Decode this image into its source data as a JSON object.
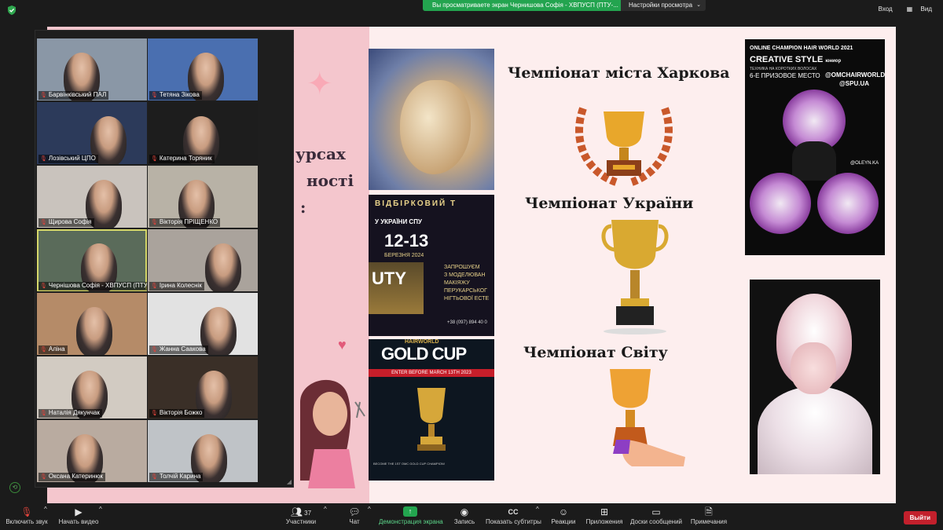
{
  "top_bar": {
    "share_banner": "Вы просматриваете экран Чернишова Софія - ХВПУСП (ПТУ-...",
    "view_settings": "Настройки просмотра",
    "right_items": [
      "Вход",
      "Вид"
    ]
  },
  "slide": {
    "partial_lines": [
      "урсах",
      "ності",
      ":"
    ],
    "champ_city": "Чемпіонат міста Харкова",
    "champ_ukraine": "Чемпіонат України",
    "champ_world": "Чемпіонат Світу",
    "poster1": {
      "heading": "ВІДБІРКОВИЙ Т",
      "subheading": "У УКРАЇНИ СПУ",
      "dates": "12-13",
      "month": "БЕРЕЗНЯ 2024",
      "side": "ЗАПРОШУЄМ\nЗ МОДЕЛЮВАН\nМАКІЯЖУ\nПЕРУКАРСЬКОГ\nНІГТЬОВОЇ ЕСТЕ",
      "phone": "+38 (097) 894 40 0",
      "banner_text": "UTY"
    },
    "poster2": {
      "title": "GOLD CUP",
      "top": "HAIRWORLD",
      "enter": "ENTER BEFORE MARCH 13TH 2023",
      "bottom": "BECOME THE 1ST OMC GOLD CUP CHAMPION!"
    },
    "creative": {
      "line1": "ONLINE CHAMPION HAIR WORLD 2021",
      "title": "CREATIVE STYLE",
      "junior": "юниор",
      "tech": "ТЕХНИКА НА КОРОТКИХ ВОЛОСАХ",
      "place": "6-Е ПРИЗОВОЕ МЕСТО",
      "handle1": "@OMCHAIRWORLD",
      "handle2": "@SPU.UA",
      "credit": "@OLEYN.KA"
    }
  },
  "gallery": {
    "tiles": [
      {
        "name": "Барвінківський ПАЛ",
        "bg": "#8a97a6"
      },
      {
        "name": "Тетяна Зікова",
        "bg": "#4a6fb0"
      },
      {
        "name": "Лозівський ЦПО",
        "bg": "#2c3a5a"
      },
      {
        "name": "Катерина Торяник",
        "bg": "#1d1d1d"
      },
      {
        "name": "Щирова Софія",
        "bg": "#c9c3bd"
      },
      {
        "name": "Вікторія ПРІЩЕНКО",
        "bg": "#b8b2a6"
      },
      {
        "name": "Чернішова Софія - ХВПУСП (ПТУ-...",
        "bg": "#5a6b5a"
      },
      {
        "name": "Ірина Колеснік",
        "bg": "#aaa39c"
      },
      {
        "name": "Аліна",
        "bg": "#b58b68"
      },
      {
        "name": "Жанна Саакова",
        "bg": "#e2e2e2"
      },
      {
        "name": "Наталія Дякунчак",
        "bg": "#d2cbc2"
      },
      {
        "name": "Вікторія Божко",
        "bg": "#3a2f27"
      },
      {
        "name": "Оксана Катеринюк",
        "bg": "#b9aba0"
      },
      {
        "name": "Толчій Карина",
        "bg": "#bfc3c7"
      }
    ]
  },
  "toolbar": {
    "mute": "Включить звук",
    "video": "Начать видео",
    "participants": "Участники",
    "participants_count": "37",
    "chat": "Чат",
    "share": "Демонстрация экрана",
    "record": "Запись",
    "captions": "Показать субтитры",
    "reactions": "Реакции",
    "apps": "Приложения",
    "whiteboards": "Доски сообщений",
    "notes": "Примечания",
    "leave": "Выйти"
  }
}
